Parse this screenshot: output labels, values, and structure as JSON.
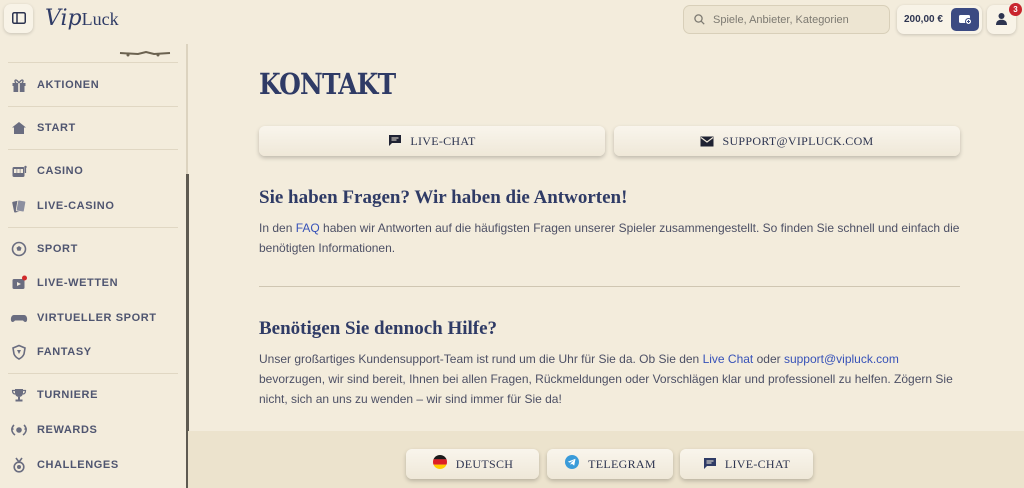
{
  "header": {
    "logo_text_1": "Vip",
    "logo_text_2": "Luck",
    "search_placeholder": "Spiele, Anbieter, Kategorien",
    "balance": "200,00 €",
    "notification_count": "3"
  },
  "sidebar": {
    "items": [
      {
        "label": "AKTIONEN",
        "icon": "gift-icon"
      },
      {
        "label": "START",
        "icon": "home-icon"
      },
      {
        "label": "CASINO",
        "icon": "slot-machine-icon"
      },
      {
        "label": "LIVE-CASINO",
        "icon": "cards-icon"
      },
      {
        "label": "SPORT",
        "icon": "soccer-ball-icon"
      },
      {
        "label": "LIVE-WETTEN",
        "icon": "live-tv-icon"
      },
      {
        "label": "VIRTUELLER SPORT",
        "icon": "gamepad-icon"
      },
      {
        "label": "FANTASY",
        "icon": "fantasy-shield-icon"
      },
      {
        "label": "TURNIERE",
        "icon": "trophy-icon"
      },
      {
        "label": "REWARDS",
        "icon": "laurel-icon"
      },
      {
        "label": "CHALLENGES",
        "icon": "medal-icon"
      }
    ]
  },
  "main": {
    "title": "KONTAKT",
    "live_chat_label": "LIVE-CHAT",
    "email_label": "SUPPORT@VIPLUCK.COM",
    "section1": {
      "heading": "Sie haben Fragen? Wir haben die Antworten!",
      "text_before": "In den ",
      "link": "FAQ",
      "text_after": " haben wir Antworten auf die häufigsten Fragen unserer Spieler zusammengestellt. So finden Sie schnell und einfach die benötigten Informationen."
    },
    "section2": {
      "heading": "Benötigen Sie dennoch Hilfe?",
      "text_1": "Unser großartiges Kundensupport-Team ist rund um die Uhr für Sie da. Ob Sie den ",
      "link_1": "Live Chat",
      "text_2": " oder ",
      "link_2": "support@vipluck.com",
      "text_3": " bevorzugen, wir sind bereit, Ihnen bei allen Fragen, Rückmeldungen oder Vorschlägen klar und professionell zu helfen. Zögern Sie nicht, sich an uns zu wenden – wir sind immer für Sie da!"
    }
  },
  "footer": {
    "buttons": [
      {
        "label": "DEUTSCH",
        "icon": "german-flag-icon"
      },
      {
        "label": "TELEGRAM",
        "icon": "telegram-icon"
      },
      {
        "label": "LIVE-CHAT",
        "icon": "chat-icon"
      }
    ]
  },
  "colors": {
    "background": "#f3ecdc",
    "brand_navy": "#2f3b66",
    "link": "#3752b8",
    "badge_red": "#c9252d"
  }
}
